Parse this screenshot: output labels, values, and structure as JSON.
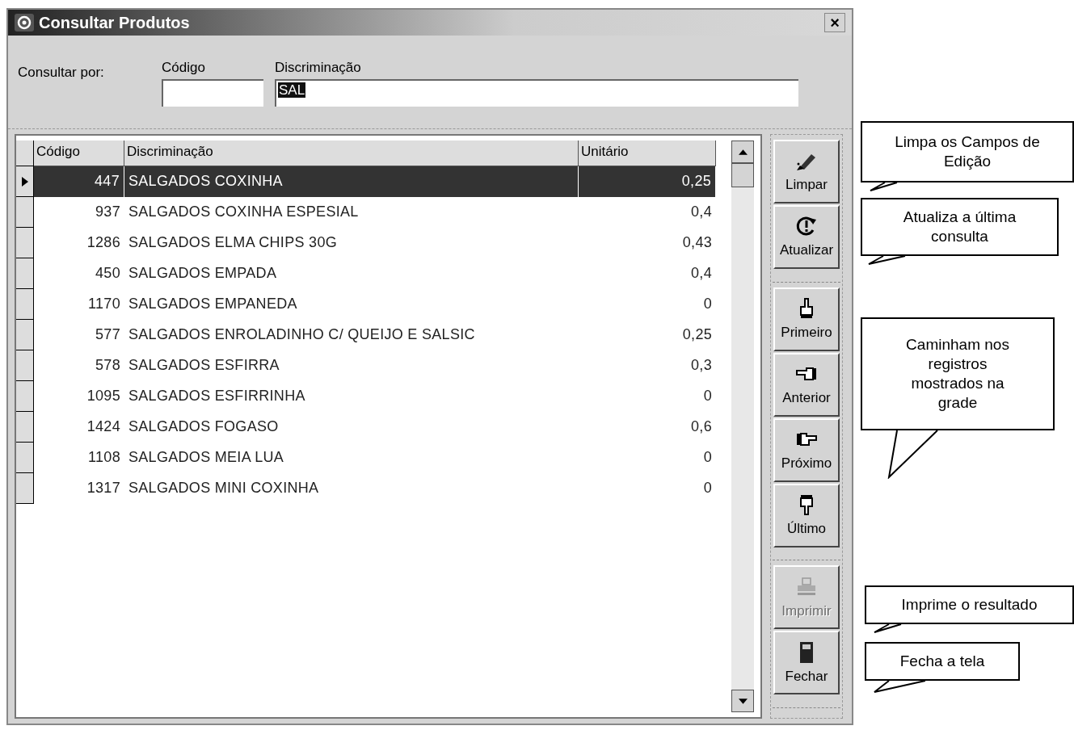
{
  "window": {
    "title": "Consultar Produtos",
    "close": "×"
  },
  "search": {
    "label": "Consultar por:",
    "fields": [
      {
        "label": "Código"
      },
      {
        "label": "Discriminação",
        "value": "SAL",
        "text_selected": true
      }
    ]
  },
  "table": {
    "columns": [
      "Código",
      "Discriminação",
      "Unitário"
    ],
    "rows": [
      {
        "codigo": "447",
        "discriminacao": "SALGADOS COXINHA",
        "unitario": "0,25",
        "selected": true
      },
      {
        "codigo": "937",
        "discriminacao": "SALGADOS COXINHA ESPESIAL",
        "unitario": "0,4",
        "selected": false
      },
      {
        "codigo": "1286",
        "discriminacao": "SALGADOS ELMA CHIPS 30G",
        "unitario": "0,43",
        "selected": false
      },
      {
        "codigo": "450",
        "discriminacao": "SALGADOS EMPADA",
        "unitario": "0,4",
        "selected": false
      },
      {
        "codigo": "1170",
        "discriminacao": "SALGADOS EMPANEDA",
        "unitario": "0",
        "selected": false
      },
      {
        "codigo": "577",
        "discriminacao": "SALGADOS ENROLADINHO C/ QUEIJO E SALSIC",
        "unitario": "0,25",
        "selected": false
      },
      {
        "codigo": "578",
        "discriminacao": "SALGADOS ESFIRRA",
        "unitario": "0,3",
        "selected": false
      },
      {
        "codigo": "1095",
        "discriminacao": "SALGADOS ESFIRRINHA",
        "unitario": "0",
        "selected": false
      },
      {
        "codigo": "1424",
        "discriminacao": "SALGADOS FOGASO",
        "unitario": "0,6",
        "selected": false
      },
      {
        "codigo": "1108",
        "discriminacao": "SALGADOS MEIA LUA",
        "unitario": "0",
        "selected": false
      },
      {
        "codigo": "1317",
        "discriminacao": "SALGADOS MINI COXINHA",
        "unitario": "0",
        "selected": false
      }
    ]
  },
  "toolbar": [
    {
      "kind": "clear",
      "label": "Limpar",
      "disabled": false,
      "group_start": false
    },
    {
      "kind": "refresh",
      "label": "Atualizar",
      "disabled": false,
      "group_start": false
    },
    {
      "kind": "first",
      "label": "Primeiro",
      "disabled": false,
      "group_start": true
    },
    {
      "kind": "previous",
      "label": "Anterior",
      "disabled": false,
      "group_start": false
    },
    {
      "kind": "next",
      "label": "Próximo",
      "disabled": false,
      "group_start": false
    },
    {
      "kind": "last",
      "label": "Último",
      "disabled": false,
      "group_start": false
    },
    {
      "kind": "print",
      "label": "Imprimir",
      "disabled": true,
      "group_start": true
    },
    {
      "kind": "close",
      "label": "Fechar",
      "disabled": false,
      "group_start": false
    }
  ],
  "callouts": [
    {
      "text": "Limpa os Campos de Edição"
    },
    {
      "text": "Atualiza a última consulta"
    },
    {
      "text": "Caminham nos registros mostrados na grade"
    },
    {
      "text": "Imprime o resultado"
    },
    {
      "text": "Fecha a tela"
    }
  ]
}
